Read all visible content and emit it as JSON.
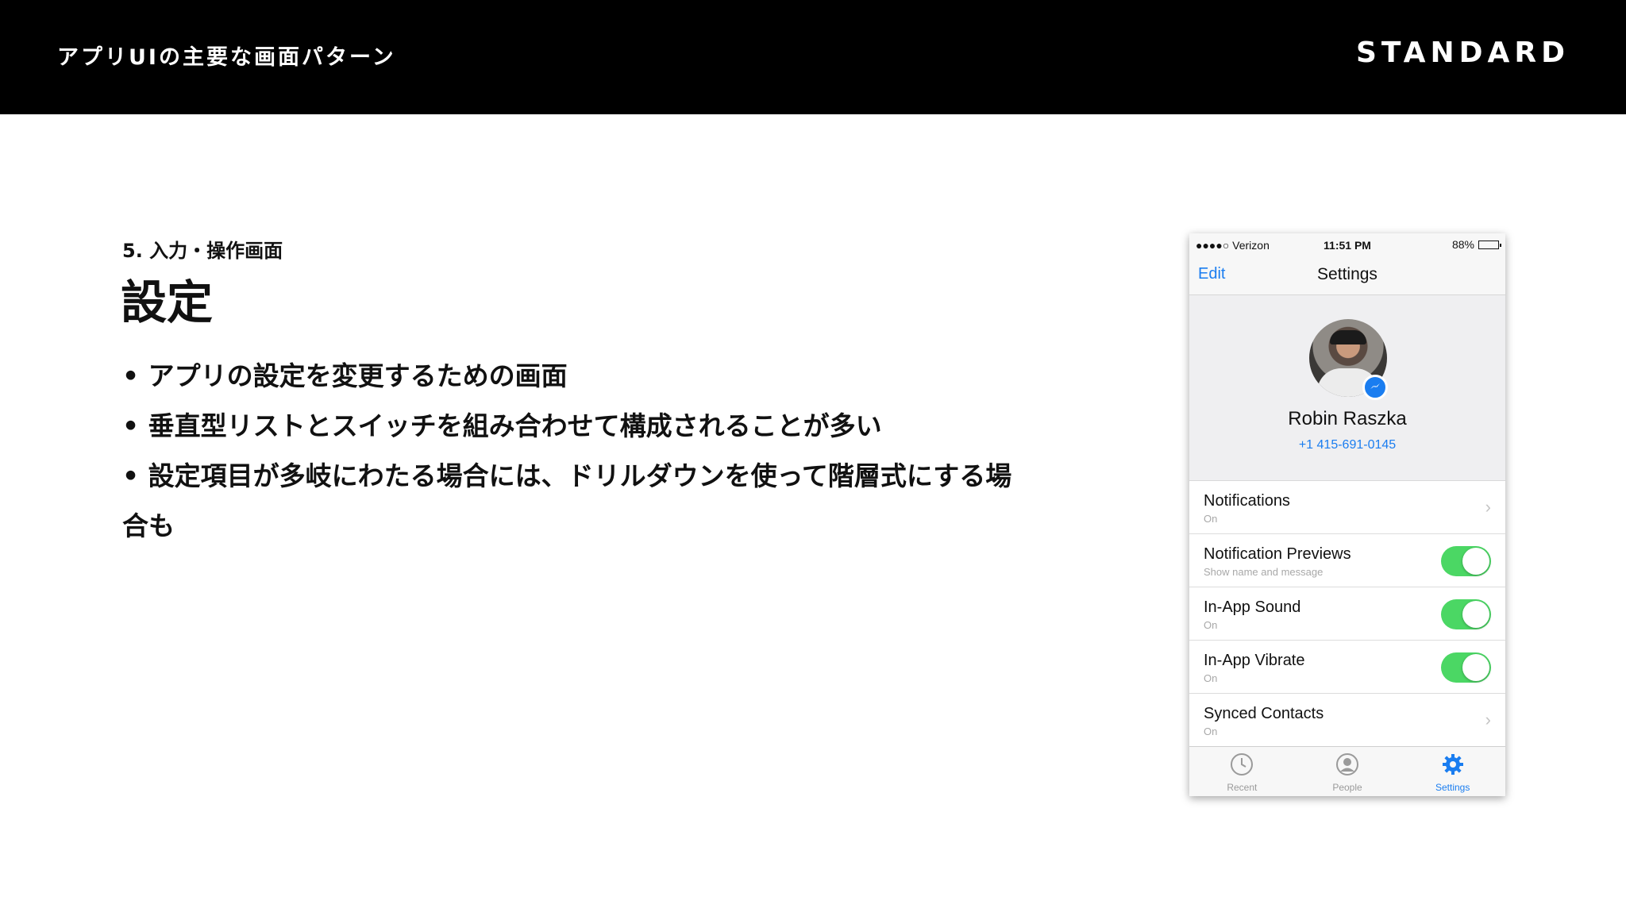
{
  "header": {
    "deck_title": "アプリUIの主要な画面パターン",
    "brand": "STANDARD"
  },
  "slide": {
    "section_label": "5. 入力・操作画面",
    "heading": "設定",
    "bullets": [
      "• アプリの設定を変更するための画面",
      "• 垂直型リストとスイッチを組み合わせて構成されることが多い",
      "• 設定項目が多岐にわたる場合には、ドリルダウンを使って階層式にする場合も"
    ]
  },
  "phone": {
    "status": {
      "carrier": "●●●●○ Verizon",
      "time": "11:51 PM",
      "battery": "88%"
    },
    "nav": {
      "edit_label": "Edit",
      "title": "Settings"
    },
    "profile": {
      "name": "Robin Raszka",
      "phone_number": "+1 415-691-0145"
    },
    "rows": [
      {
        "title": "Notifications",
        "subtitle": "On",
        "control": "chevron"
      },
      {
        "title": "Notification Previews",
        "subtitle": "Show name and message",
        "control": "toggle",
        "on": true
      },
      {
        "title": "In-App Sound",
        "subtitle": "On",
        "control": "toggle",
        "on": true
      },
      {
        "title": "In-App Vibrate",
        "subtitle": "On",
        "control": "toggle",
        "on": true
      },
      {
        "title": "Synced Contacts",
        "subtitle": "On",
        "control": "chevron"
      }
    ],
    "tabs": [
      {
        "label": "Recent",
        "icon": "clock-icon"
      },
      {
        "label": "People",
        "icon": "person-icon"
      },
      {
        "label": "Settings",
        "icon": "gear-icon",
        "active": true
      }
    ],
    "colors": {
      "accent": "#1a7df0",
      "toggle_on": "#4bd764"
    }
  }
}
